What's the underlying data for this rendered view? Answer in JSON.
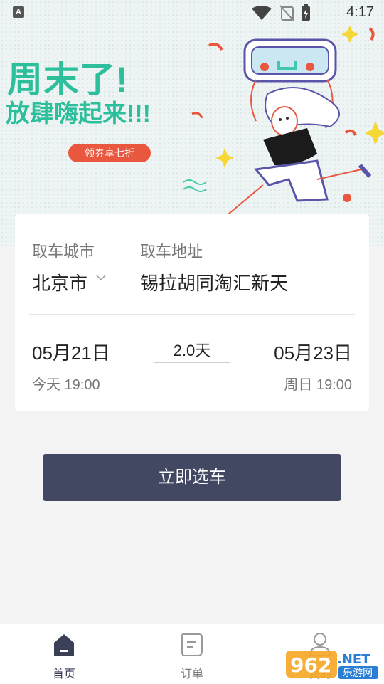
{
  "status_bar": {
    "time": "4:17",
    "app_badge": "A"
  },
  "banner": {
    "title_line1": "周末了!",
    "title_line2": "放肆嗨起来!!!",
    "coupon_text": "领券享七折"
  },
  "booking": {
    "city_label": "取车城市",
    "city_value": "北京市",
    "address_label": "取车地址",
    "address_value": "锡拉胡同淘汇新天",
    "pickup_date": "05月21日",
    "pickup_sub": "今天 19:00",
    "duration": "2.0天",
    "return_date": "05月23日",
    "return_sub": "周日 19:00"
  },
  "action_button": "立即选车",
  "tabs": [
    {
      "label": "首页",
      "icon": "home-icon",
      "active": true
    },
    {
      "label": "订单",
      "icon": "order-icon",
      "active": false
    },
    {
      "label": "我的",
      "icon": "user-icon",
      "active": false
    }
  ],
  "watermark": {
    "number": "962",
    "suffix": ".NET",
    "site": "乐游网"
  },
  "colors": {
    "accent_green": "#2dbf9b",
    "coupon_red": "#e9573e",
    "button_bg": "#434862",
    "tab_active": "#333a52"
  }
}
